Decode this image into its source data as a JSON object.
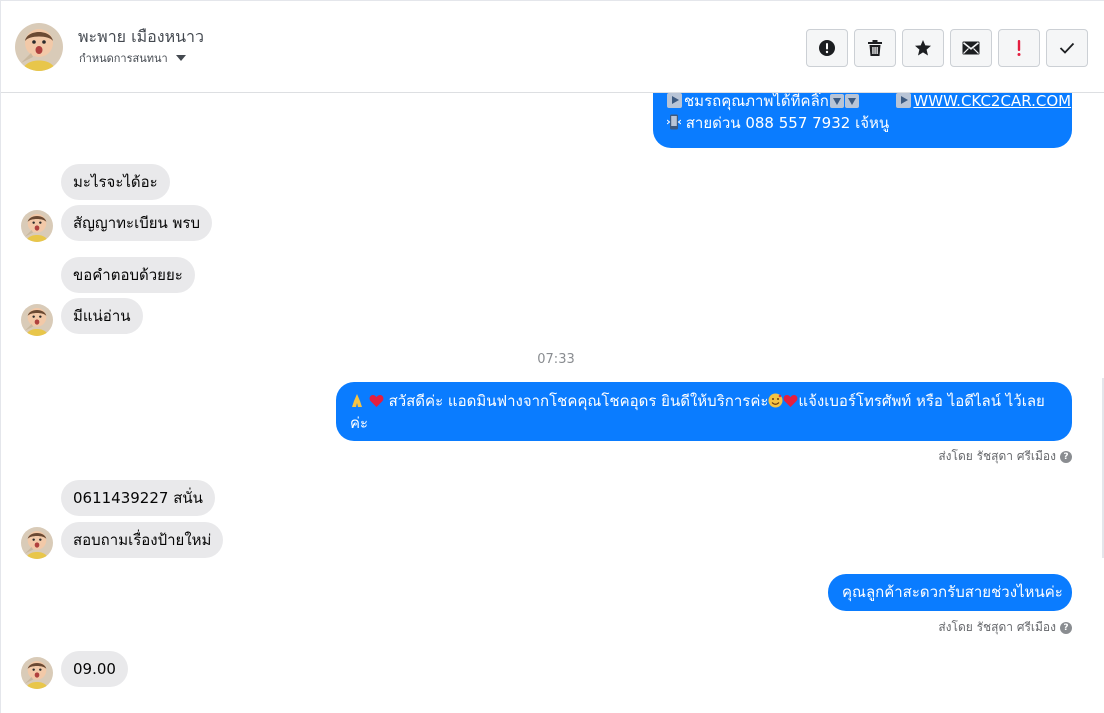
{
  "header": {
    "contact_name": "พะพาย เมืองหนาว",
    "assign_label": "กำหนดการสนทนา",
    "actions": [
      {
        "icon": "alert-circle-icon",
        "name": "mark-spam-button"
      },
      {
        "icon": "trash-icon",
        "name": "delete-button"
      },
      {
        "icon": "star-icon",
        "name": "star-button"
      },
      {
        "icon": "envelope-icon",
        "name": "mark-unread-button"
      },
      {
        "icon": "exclamation-icon",
        "name": "follow-up-button"
      },
      {
        "icon": "checkmark-icon",
        "name": "mark-done-button"
      }
    ]
  },
  "messages": {
    "top_outgoing": {
      "line1_text": "ชมรถคุณภาพได้ที่คลิ๊ก",
      "link": "WWW.CKC2CAR.COM",
      "line2_text": "สายด่วน 088 557 7932 เจ้หนู"
    },
    "incoming_1": "มะไรจะได้อะ",
    "incoming_2": "สัญญาทะเบียน พรบ",
    "incoming_3": "ขอคำตอบด้วยยะ",
    "incoming_4": "มีแน่อ่าน",
    "timestamp": "07:33",
    "outgoing_greeting_a": "สวัสดีค่ะ แอดมินฟางจากโชคคุณโชคอุดร ยินดีให้บริการค่ะ",
    "outgoing_greeting_b": "แจ้งเบอร์โทรศัพท์ หรือ ไอดีไลน์  ไว้เลย",
    "outgoing_greeting_c": "ค่ะ",
    "sent_by": "ส่งโดย รัชสุดา ศรีเมือง",
    "incoming_5": "0611439227  สนั่น",
    "incoming_6": "สอบถามเรื่องป้ายใหม่",
    "outgoing_call_time": "คุณลูกค้าสะดวกรับสายช่วงไหนค่ะ",
    "incoming_7": "09.00"
  },
  "colors": {
    "outgoing_bubble": "#0a7cff",
    "incoming_bubble": "#e9e9eb",
    "follow_up_red": "#e41e3f"
  }
}
